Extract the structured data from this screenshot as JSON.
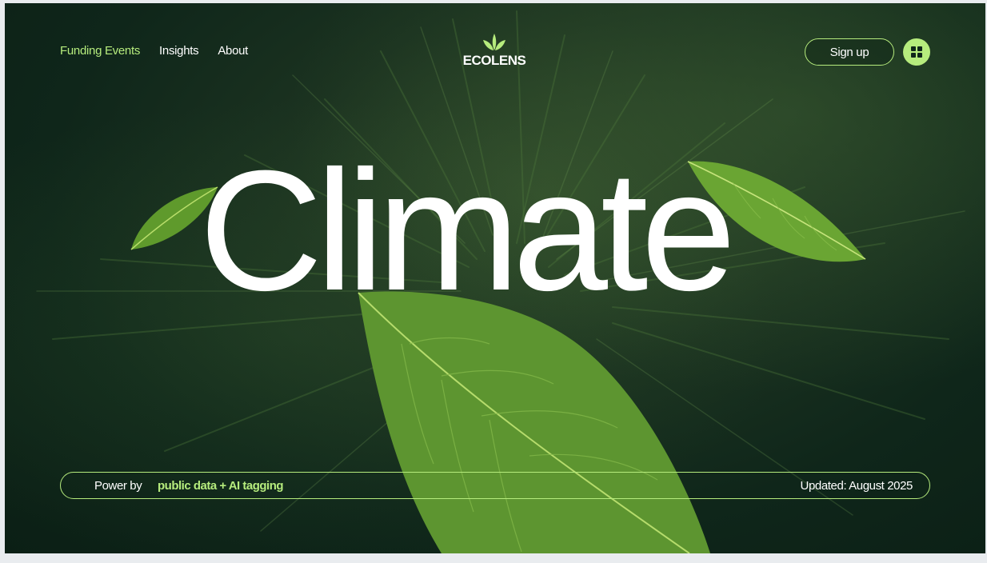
{
  "nav": {
    "links": [
      "Funding Events",
      "Insights",
      "About"
    ]
  },
  "brand": {
    "name": "ECOLENS",
    "icon": "sprout-icon"
  },
  "actions": {
    "signup_label": "Sign up",
    "menu_icon": "grid-icon"
  },
  "hero": {
    "headline": "Climate"
  },
  "footer_bar": {
    "power_label": "Power by",
    "source": "public data + AI tagging",
    "updated": "Updated: August 2025"
  },
  "colors": {
    "accent": "#b6ec7d",
    "background": "#0f261a",
    "text": "#ffffff"
  }
}
